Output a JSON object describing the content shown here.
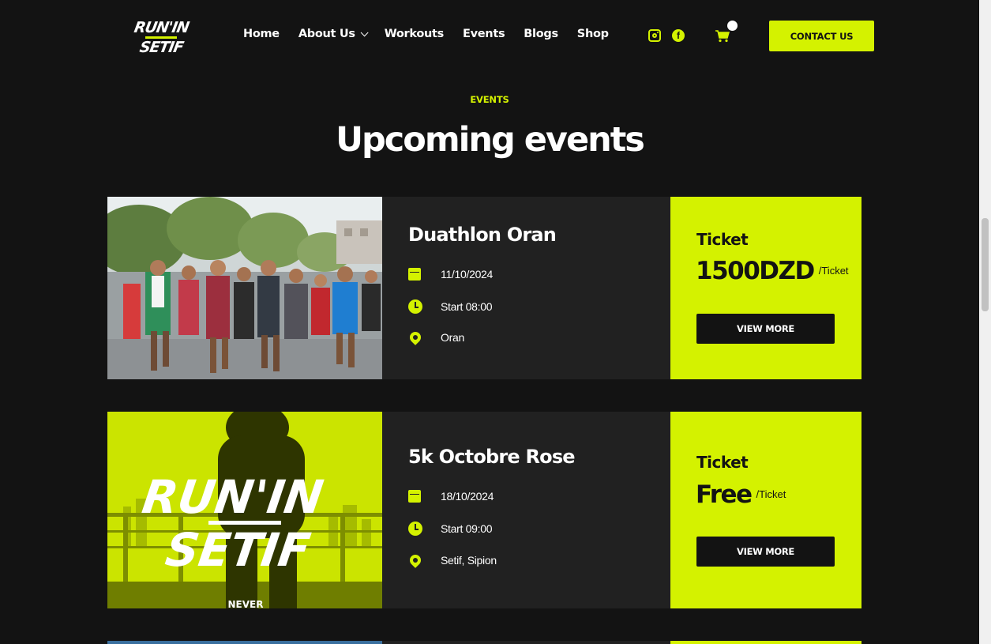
{
  "brand": {
    "logo_line1": "RUN'IN",
    "logo_line2": "SETIF",
    "accent": "#d4f200",
    "background": "#131313"
  },
  "nav": {
    "items": [
      {
        "label": "Home"
      },
      {
        "label": "About Us"
      },
      {
        "label": "Workouts"
      },
      {
        "label": "Events"
      },
      {
        "label": "Blogs"
      },
      {
        "label": "Shop"
      }
    ],
    "social_icons": [
      "instagram-icon",
      "facebook-icon"
    ],
    "cart_icon": "cart-icon",
    "contact_label": "CONTACT US"
  },
  "section": {
    "eyebrow": "EVENTS",
    "title": "Upcoming events"
  },
  "events": [
    {
      "title": "Duathlon Oran",
      "date": "11/10/2024",
      "time": "Start 08:00",
      "location": "Oran",
      "ticket_label": "Ticket",
      "price": "1500DZD",
      "per": "/Ticket",
      "button": "VIEW MORE",
      "image": "runners-photo"
    },
    {
      "title": "5k Octobre Rose",
      "date": "18/10/2024",
      "time": "Start 09:00",
      "location": "Setif, Sipion",
      "ticket_label": "Ticket",
      "price": "Free",
      "per": "/Ticket",
      "button": "VIEW MORE",
      "image": "runin-setif-poster",
      "poster_line1": "RUN'IN",
      "poster_line2": "SETIF",
      "poster_tag": "NEVER"
    }
  ]
}
